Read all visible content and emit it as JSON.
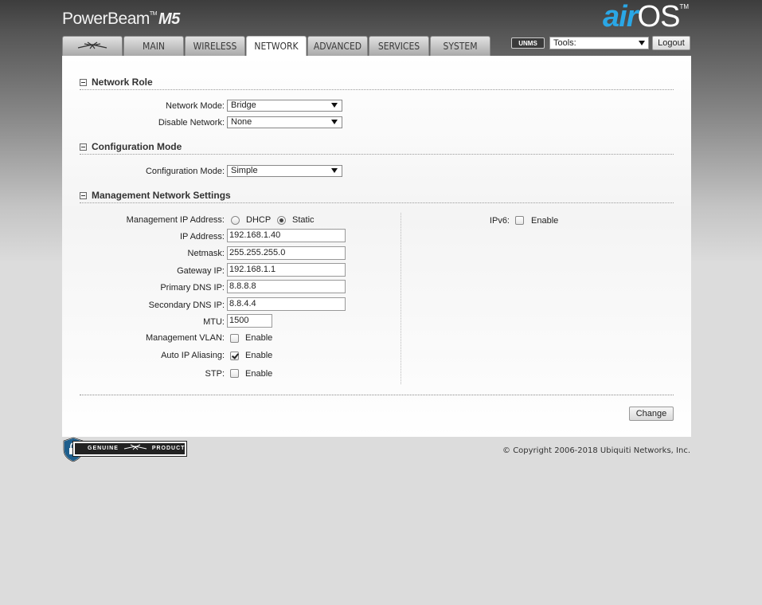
{
  "header": {
    "brand": "PowerBeam",
    "brand_tm": "TM",
    "brand_model": "M5",
    "logo_air": "air",
    "logo_os": "OS",
    "logo_tm": "TM"
  },
  "tabs": [
    {
      "label": "",
      "icon": "ubiquiti-logo-icon"
    },
    {
      "label": "MAIN"
    },
    {
      "label": "WIRELESS"
    },
    {
      "label": "NETWORK",
      "active": true
    },
    {
      "label": "ADVANCED"
    },
    {
      "label": "SERVICES"
    },
    {
      "label": "SYSTEM"
    }
  ],
  "toolbar": {
    "unms_label": "UNMS",
    "tools_value": "Tools:",
    "logout_label": "Logout"
  },
  "network_role": {
    "title": "Network Role",
    "network_mode_label": "Network Mode:",
    "network_mode_value": "Bridge",
    "disable_network_label": "Disable Network:",
    "disable_network_value": "None"
  },
  "configuration_mode": {
    "title": "Configuration Mode",
    "label": "Configuration Mode:",
    "value": "Simple"
  },
  "management": {
    "title": "Management Network Settings",
    "ip_mode_label": "Management IP Address:",
    "dhcp_label": "DHCP",
    "static_label": "Static",
    "ip_mode_selected": "Static",
    "ip_address_label": "IP Address:",
    "ip_address": "192.168.1.40",
    "netmask_label": "Netmask:",
    "netmask": "255.255.255.0",
    "gateway_label": "Gateway IP:",
    "gateway": "192.168.1.1",
    "primary_dns_label": "Primary DNS IP:",
    "primary_dns": "8.8.8.8",
    "secondary_dns_label": "Secondary DNS IP:",
    "secondary_dns": "8.8.4.4",
    "mtu_label": "MTU:",
    "mtu": "1500",
    "vlan_label": "Management VLAN:",
    "vlan_enable_label": "Enable",
    "vlan_enabled": false,
    "auto_ip_label": "Auto IP Aliasing:",
    "auto_ip_enable_label": "Enable",
    "auto_ip_enabled": true,
    "stp_label": "STP:",
    "stp_enable_label": "Enable",
    "stp_enabled": false,
    "ipv6_label": "IPv6:",
    "ipv6_enable_label": "Enable",
    "ipv6_enabled": false
  },
  "actions": {
    "change_label": "Change"
  },
  "footer": {
    "genuine_label": "GENUINE",
    "product_label": "PRODUCT",
    "copyright": "© Copyright 2006-2018 Ubiquiti Networks, Inc."
  }
}
